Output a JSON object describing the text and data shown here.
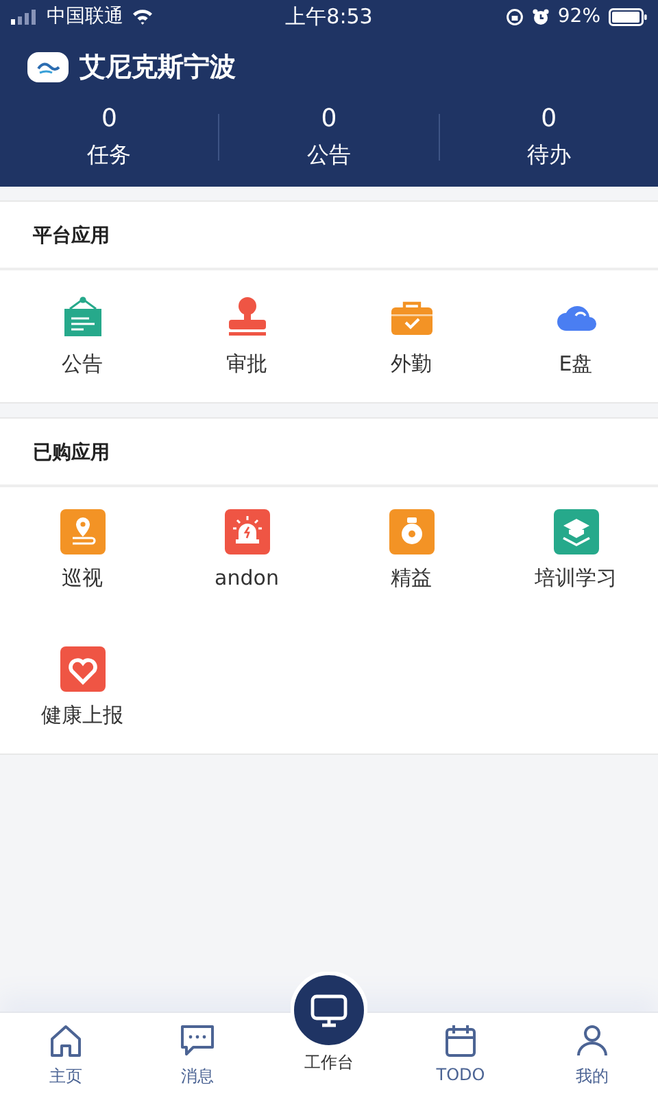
{
  "status_bar": {
    "carrier": "中国联通",
    "time": "上午8:53",
    "battery": "92%"
  },
  "header": {
    "title": "艾尼克斯宁波"
  },
  "stats": [
    {
      "value": "0",
      "label": "任务"
    },
    {
      "value": "0",
      "label": "公告"
    },
    {
      "value": "0",
      "label": "待办"
    }
  ],
  "sections": [
    {
      "title": "平台应用",
      "apps": [
        {
          "label": "公告"
        },
        {
          "label": "审批"
        },
        {
          "label": "外勤"
        },
        {
          "label": "E盘"
        }
      ]
    },
    {
      "title": "已购应用",
      "apps": [
        {
          "label": "巡视"
        },
        {
          "label": "andon"
        },
        {
          "label": "精益"
        },
        {
          "label": "培训学习"
        },
        {
          "label": "健康上报"
        }
      ]
    }
  ],
  "tabs": [
    {
      "label": "主页",
      "selected": false
    },
    {
      "label": "消息",
      "selected": false
    },
    {
      "label": "工作台",
      "selected": true
    },
    {
      "label": "TODO",
      "selected": false
    },
    {
      "label": "我的",
      "selected": false
    }
  ]
}
